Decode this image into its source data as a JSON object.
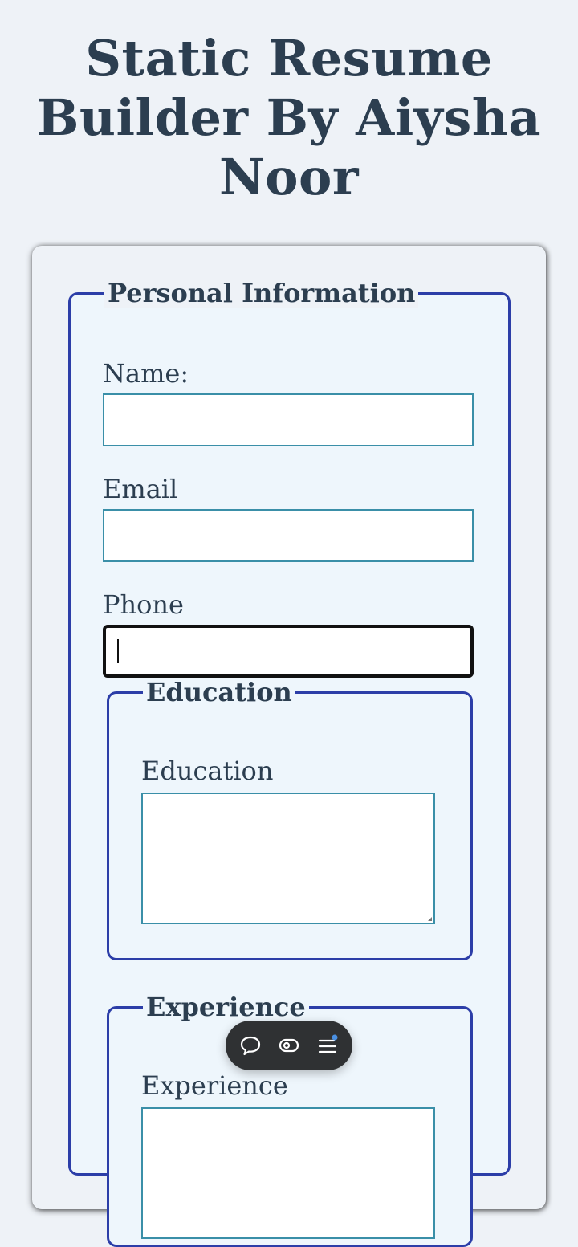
{
  "page": {
    "title": "Static Resume Builder By Aiysha Noor"
  },
  "personal": {
    "legend": "Personal Information",
    "name_label": "Name:",
    "email_label": "Email",
    "phone_label": "Phone"
  },
  "education": {
    "legend": "Education",
    "label": "Education"
  },
  "experience": {
    "legend": "Experience",
    "label": "Experience"
  },
  "toolbar": {
    "items": [
      "chat-icon",
      "eye-icon",
      "menu-icon"
    ],
    "badge_color": "#4a90e2"
  },
  "colors": {
    "fieldset_border": "#2c3ea8",
    "input_border": "#3a8fa8",
    "text": "#2c3e50",
    "background": "#eef2f7"
  }
}
